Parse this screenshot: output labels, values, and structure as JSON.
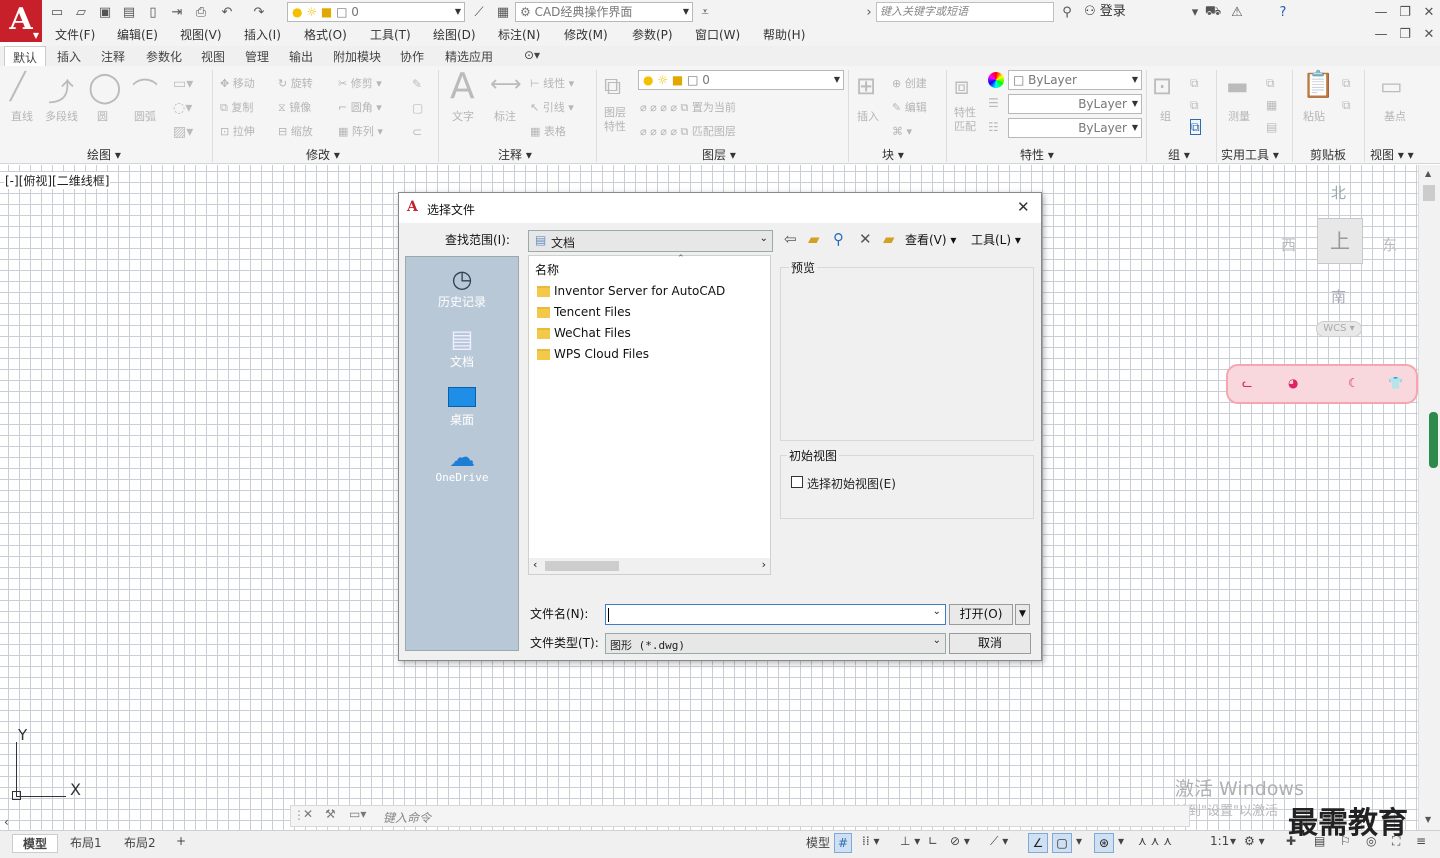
{
  "app": {
    "workspace": "CAD经典操作界面",
    "layer_value": "0",
    "search_placeholder": "键入关键字或短语",
    "login": "登录"
  },
  "menus": [
    "文件(F)",
    "编辑(E)",
    "视图(V)",
    "插入(I)",
    "格式(O)",
    "工具(T)",
    "绘图(D)",
    "标注(N)",
    "修改(M)",
    "参数(P)",
    "窗口(W)",
    "帮助(H)"
  ],
  "tabs": [
    "默认",
    "插入",
    "注释",
    "参数化",
    "视图",
    "管理",
    "输出",
    "附加模块",
    "协作",
    "精选应用"
  ],
  "ribbon": {
    "draw": {
      "label": "绘图",
      "items": [
        "直线",
        "多段线",
        "圆",
        "圆弧"
      ]
    },
    "modify": {
      "label": "修改",
      "items": [
        "移动",
        "旋转",
        "修剪",
        "复制",
        "镜像",
        "圆角",
        "拉伸",
        "缩放",
        "阵列"
      ]
    },
    "annotate": {
      "label": "注释",
      "items": [
        "文字",
        "标注",
        "线性",
        "引线",
        "表格"
      ]
    },
    "layers": {
      "label": "图层",
      "items": [
        "图层特性",
        "置为当前",
        "匹配图层"
      ],
      "layer": "0"
    },
    "block": {
      "label": "块",
      "items": [
        "插入",
        "创建",
        "编辑"
      ]
    },
    "props": {
      "label": "特性",
      "items": [
        "特性匹配"
      ],
      "bylayer": "ByLayer"
    },
    "group": {
      "label": "组",
      "items": [
        "组"
      ]
    },
    "utils": {
      "label": "实用工具",
      "items": [
        "测量"
      ]
    },
    "clip": {
      "label": "剪贴板",
      "items": [
        "粘贴"
      ]
    },
    "view": {
      "label": "视图",
      "items": [
        "基点"
      ]
    }
  },
  "viewport": {
    "label": "[-][俯视][二维线框]",
    "compass": {
      "north": "北",
      "south": "南",
      "east": "东",
      "west": "西",
      "top": "上",
      "wcs": "WCS"
    },
    "axis_x": "X",
    "axis_y": "Y"
  },
  "dialog": {
    "title": "选择文件",
    "lookin_label": "查找范围(I):",
    "lookin_value": "文档",
    "view_label": "查看(V)",
    "tools_label": "工具(L)",
    "places": [
      "历史记录",
      "文档",
      "桌面",
      "OneDrive"
    ],
    "column": "名称",
    "files": [
      "Inventor Server for AutoCAD",
      "Tencent Files",
      "WeChat Files",
      "WPS Cloud Files"
    ],
    "preview_label": "预览",
    "initview_label": "初始视图",
    "initview_check": "选择初始视图(E)",
    "filename_label": "文件名(N):",
    "filename_value": "",
    "filetype_label": "文件类型(T):",
    "filetype_value": "图形 (*.dwg)",
    "open_btn": "打开(O)",
    "cancel_btn": "取消"
  },
  "bottom": {
    "tabs": [
      "模型",
      "布局1",
      "布局2"
    ],
    "cmd_placeholder": "键入命令",
    "status_model": "模型",
    "scale": "1:1"
  },
  "overlay": {
    "watermark1": "激活 Windows",
    "watermark2": "转到\"设置\"以激活",
    "brand": "最需教育"
  }
}
